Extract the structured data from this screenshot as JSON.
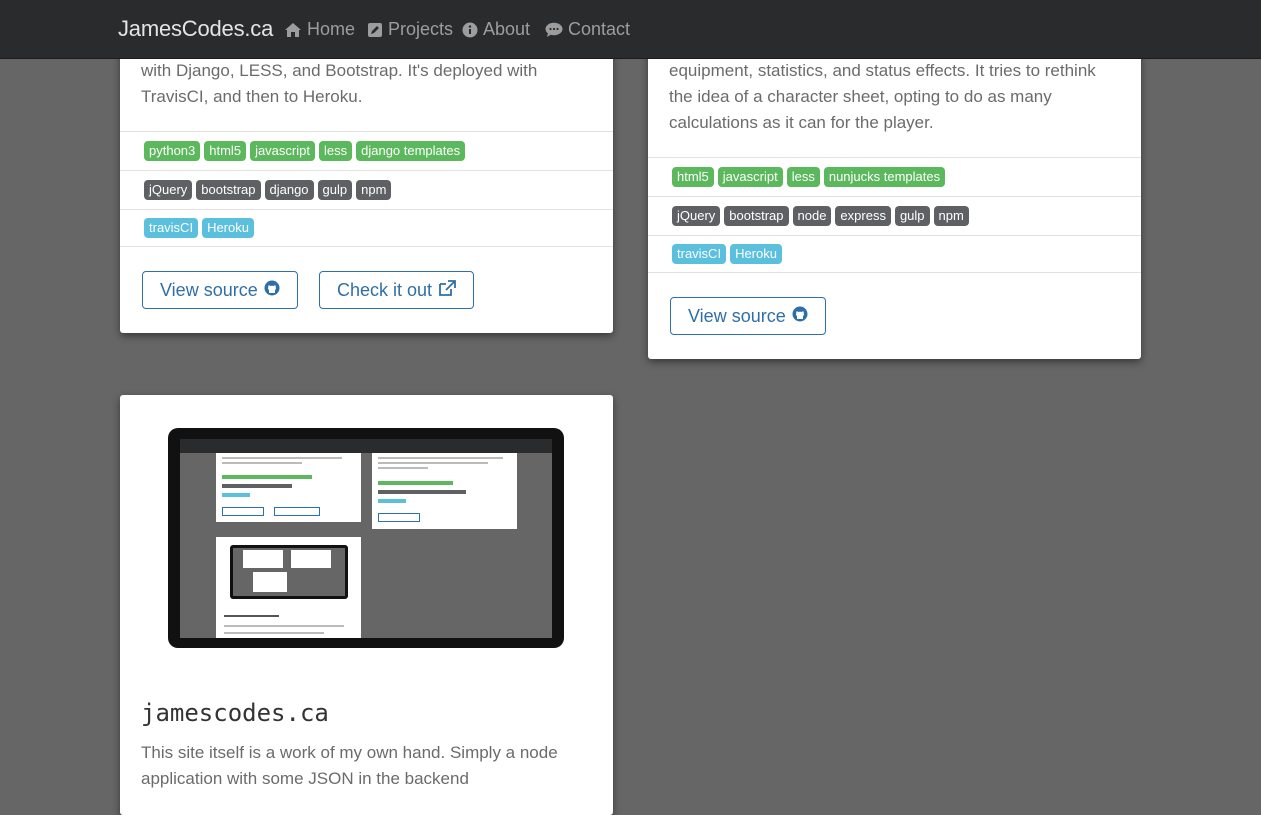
{
  "navbar": {
    "brand": "JamesCodes.ca",
    "links": [
      {
        "label": "Home",
        "icon": "home-icon"
      },
      {
        "label": "Projects",
        "icon": "edit-icon"
      },
      {
        "label": "About",
        "icon": "info-circle-icon"
      },
      {
        "label": "Contact",
        "icon": "comment-icon"
      }
    ]
  },
  "colors": {
    "navbar_bg": "#2a2b2c",
    "page_bg": "#666666",
    "tag_language": "#5cb85c",
    "tag_library": "#5e6063",
    "tag_service": "#5bc0de",
    "button_accent": "#2e6fb0"
  },
  "cards": [
    {
      "description": "with Django, LESS, and Bootstrap. It's deployed with TravisCI, and then to Heroku.",
      "languages": [
        "python3",
        "html5",
        "javascript",
        "less",
        "django templates"
      ],
      "libraries": [
        "jQuery",
        "bootstrap",
        "django",
        "gulp",
        "npm"
      ],
      "services": [
        "travisCI",
        "Heroku"
      ],
      "view_source_label": "View source",
      "check_it_out_label": "Check it out"
    },
    {
      "description": "equipment, statistics, and status effects. It tries to rethink the idea of a character sheet, opting to do as many calculations as it can for the player.",
      "languages": [
        "html5",
        "javascript",
        "less",
        "nunjucks templates"
      ],
      "libraries": [
        "jQuery",
        "bootstrap",
        "node",
        "express",
        "gulp",
        "npm"
      ],
      "services": [
        "travisCI",
        "Heroku"
      ],
      "view_source_label": "View source"
    },
    {
      "title": "jamescodes.ca",
      "description": "This site itself is a work of my own hand. Simply a node application with some JSON in the backend"
    }
  ]
}
